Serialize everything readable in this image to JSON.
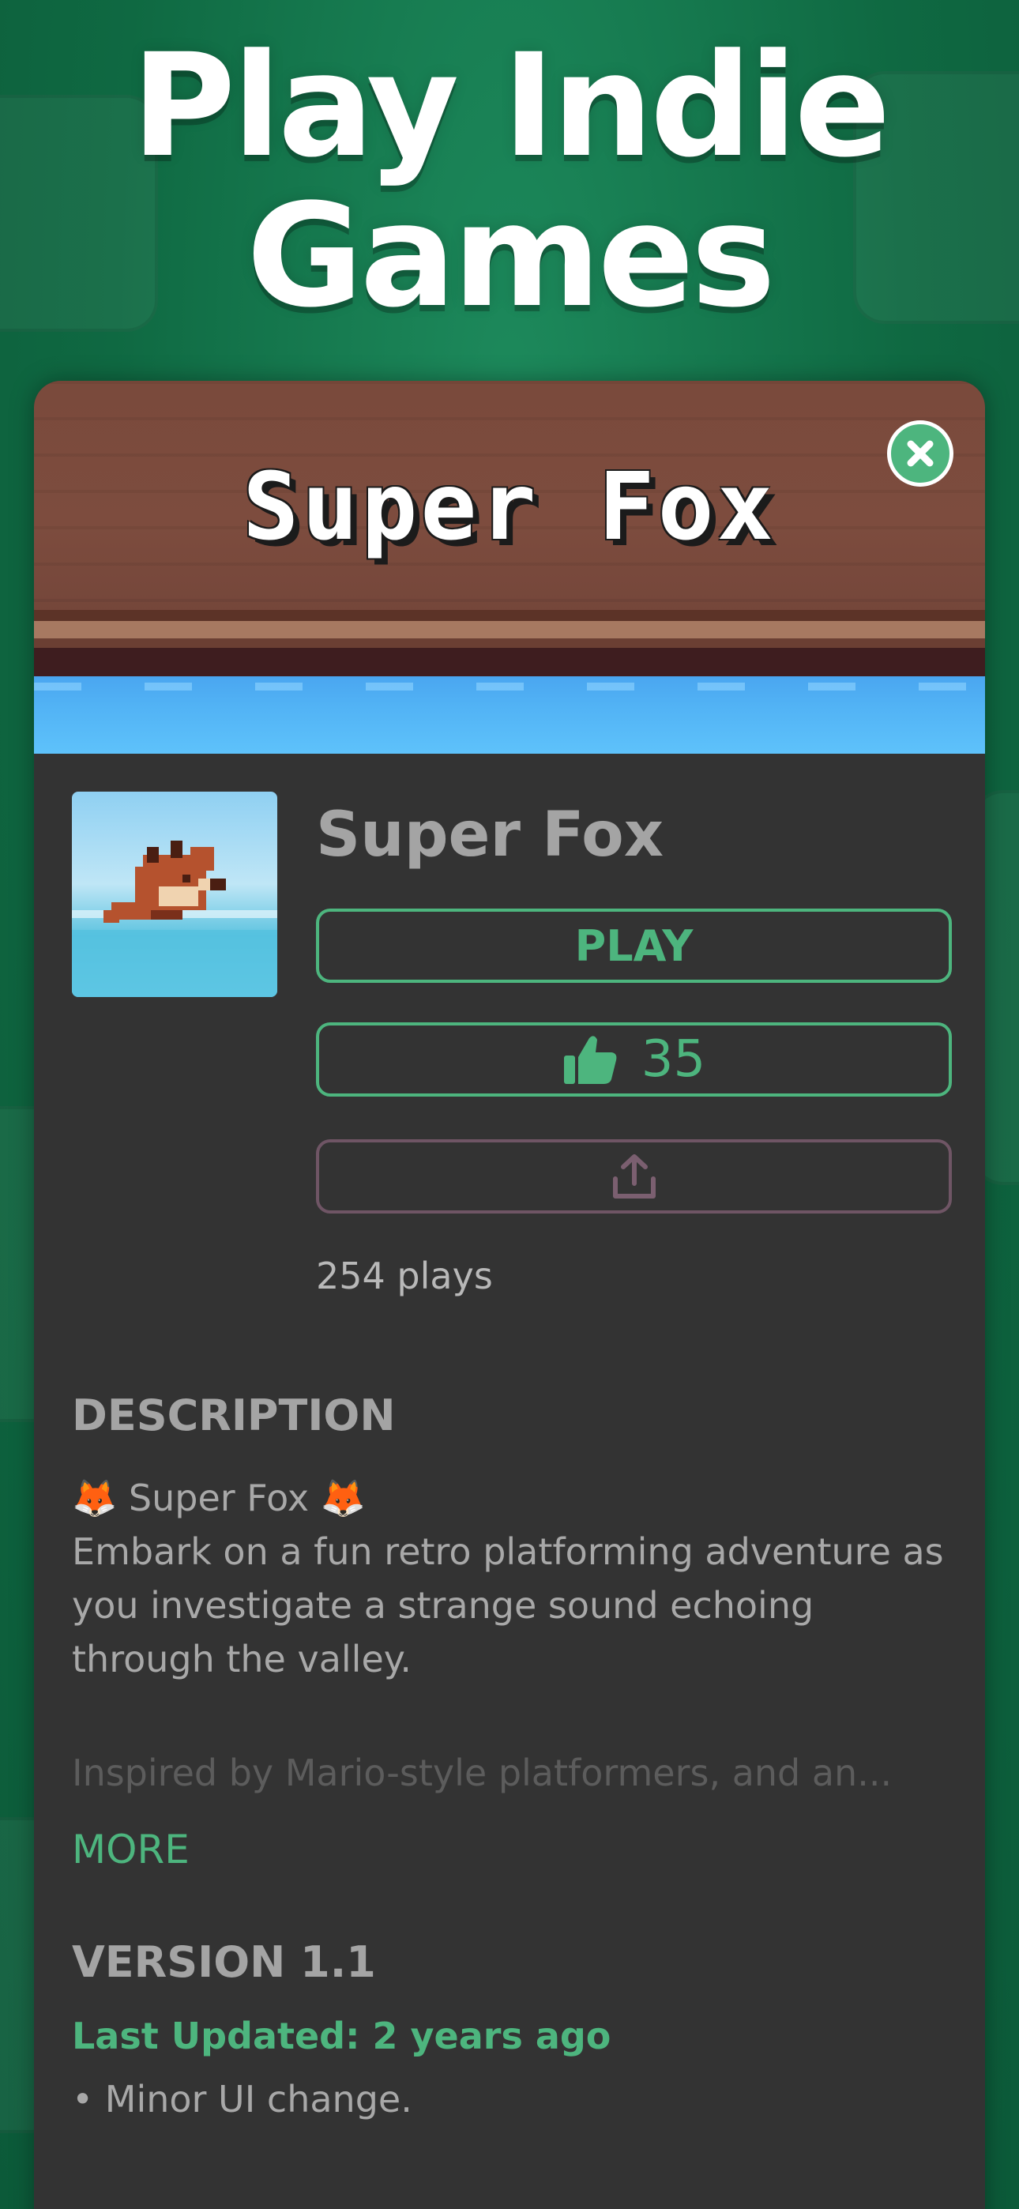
{
  "headline": {
    "line1": "Play Indie",
    "line2": "Games"
  },
  "game": {
    "banner_title": "Super Fox",
    "title": "Super Fox",
    "play_label": "PLAY",
    "likes": "35",
    "plays": "254 plays"
  },
  "description": {
    "heading": "DESCRIPTION",
    "line1": "🦊 Super Fox 🦊",
    "body": "Embark on a fun retro platforming adventure as you investigate a strange sound echoing through the valley.",
    "faded": "Inspired by Mario-style platformers, and an...",
    "more_label": "MORE"
  },
  "version": {
    "heading": "VERSION 1.1",
    "updated": "Last Updated: 2 years ago",
    "changes": "• Minor UI change."
  },
  "colors": {
    "accent": "#4db57e",
    "card_bg": "#333333",
    "background": "#13704a"
  },
  "icons": {
    "close": "close-icon",
    "like": "thumbs-up-icon",
    "share": "share-icon"
  }
}
